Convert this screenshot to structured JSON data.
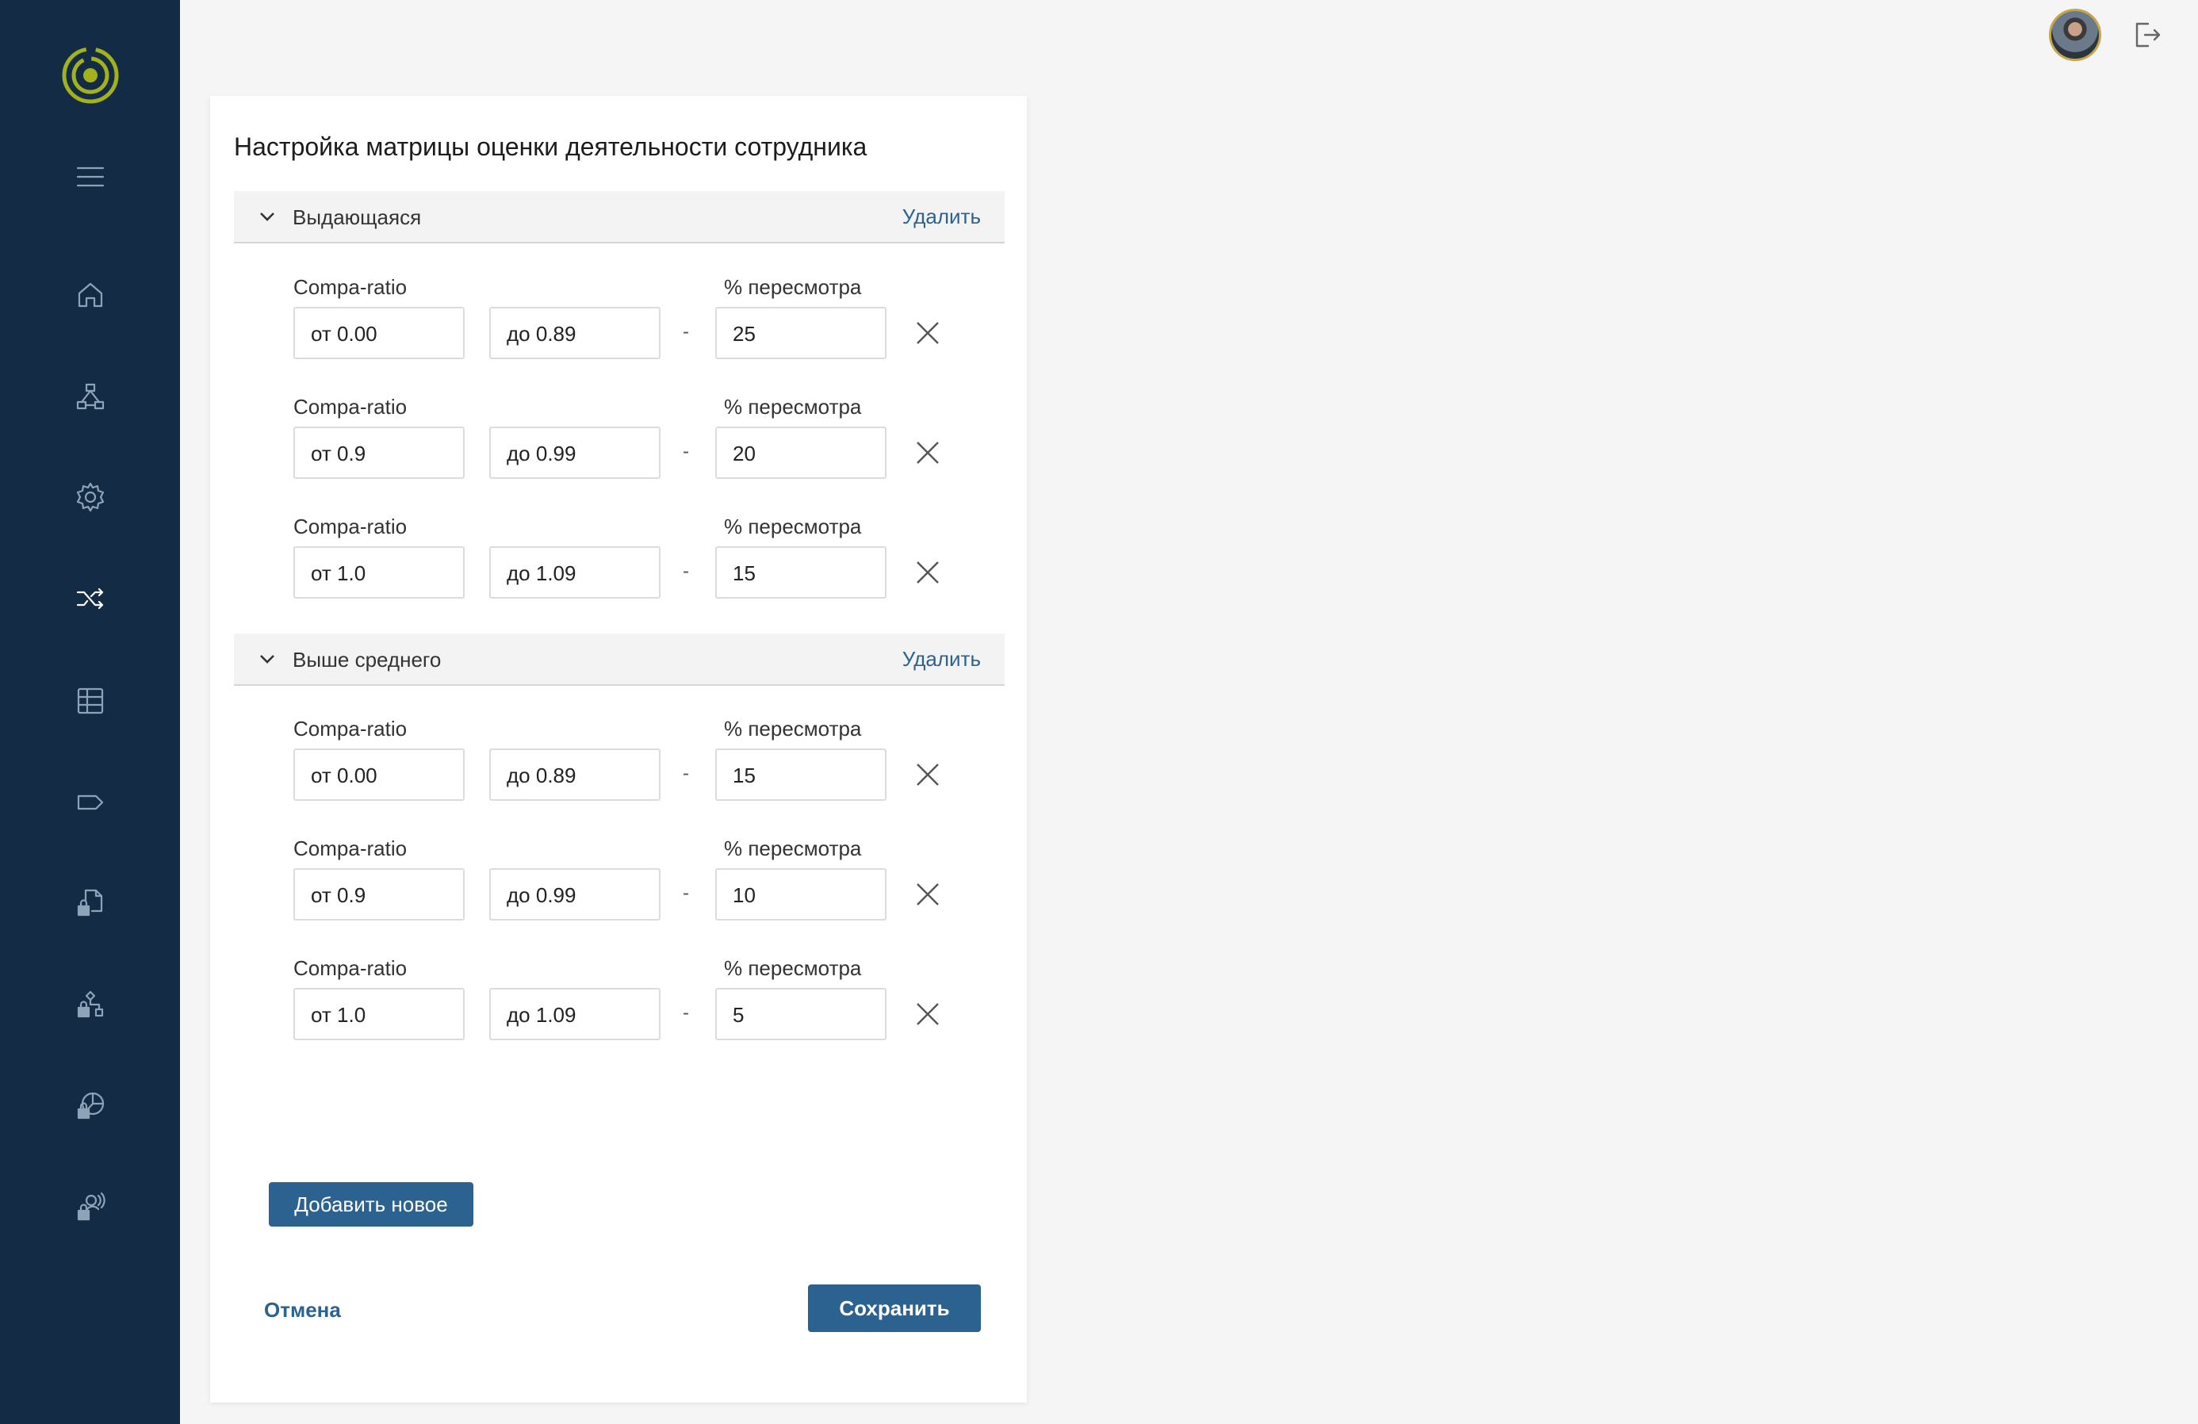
{
  "colors": {
    "sidebar_bg": "#132b44",
    "accent": "#2c6290",
    "logo": "#a3b11b",
    "page_bg": "#f5f5f5"
  },
  "sidebar": {
    "logo": "logo-rings-icon",
    "items": [
      {
        "icon": "menu-icon"
      },
      {
        "icon": "home-icon"
      },
      {
        "icon": "org-structure-icon"
      },
      {
        "icon": "gear-icon"
      },
      {
        "icon": "shuffle-icon"
      },
      {
        "icon": "table-icon"
      },
      {
        "icon": "tag-icon"
      },
      {
        "icon": "locked-document-icon"
      },
      {
        "icon": "locked-workflow-icon"
      },
      {
        "icon": "locked-chart-icon"
      },
      {
        "icon": "locked-user-broadcast-icon"
      }
    ]
  },
  "header": {
    "avatar": "user-avatar",
    "logout": "logout-icon"
  },
  "card": {
    "title": "Настройка матрицы оценки деятельности сотрудника",
    "sections": [
      {
        "title": "Выдающаяся",
        "delete_label": "Удалить",
        "rows": [
          {
            "compa_label": "Compa-ratio",
            "pct_label": "% пересмотра",
            "from": "от 0.00",
            "to": "до 0.89",
            "dash": "-",
            "pct": "25"
          },
          {
            "compa_label": "Compa-ratio",
            "pct_label": "% пересмотра",
            "from": "от 0.9",
            "to": "до 0.99",
            "dash": "-",
            "pct": "20"
          },
          {
            "compa_label": "Compa-ratio",
            "pct_label": "% пересмотра",
            "from": "от 1.0",
            "to": "до 1.09",
            "dash": "-",
            "pct": "15"
          }
        ]
      },
      {
        "title": "Выше среднего",
        "delete_label": "Удалить",
        "rows": [
          {
            "compa_label": "Compa-ratio",
            "pct_label": "% пересмотра",
            "from": "от 0.00",
            "to": "до 0.89",
            "dash": "-",
            "pct": "15"
          },
          {
            "compa_label": "Compa-ratio",
            "pct_label": "% пересмотра",
            "from": "от 0.9",
            "to": "до 0.99",
            "dash": "-",
            "pct": "10"
          },
          {
            "compa_label": "Compa-ratio",
            "pct_label": "% пересмотра",
            "from": "от 1.0",
            "to": "до 1.09",
            "dash": "-",
            "pct": "5"
          }
        ]
      }
    ],
    "add_label": "Добавить новое",
    "cancel_label": "Отмена",
    "save_label": "Сохранить"
  }
}
